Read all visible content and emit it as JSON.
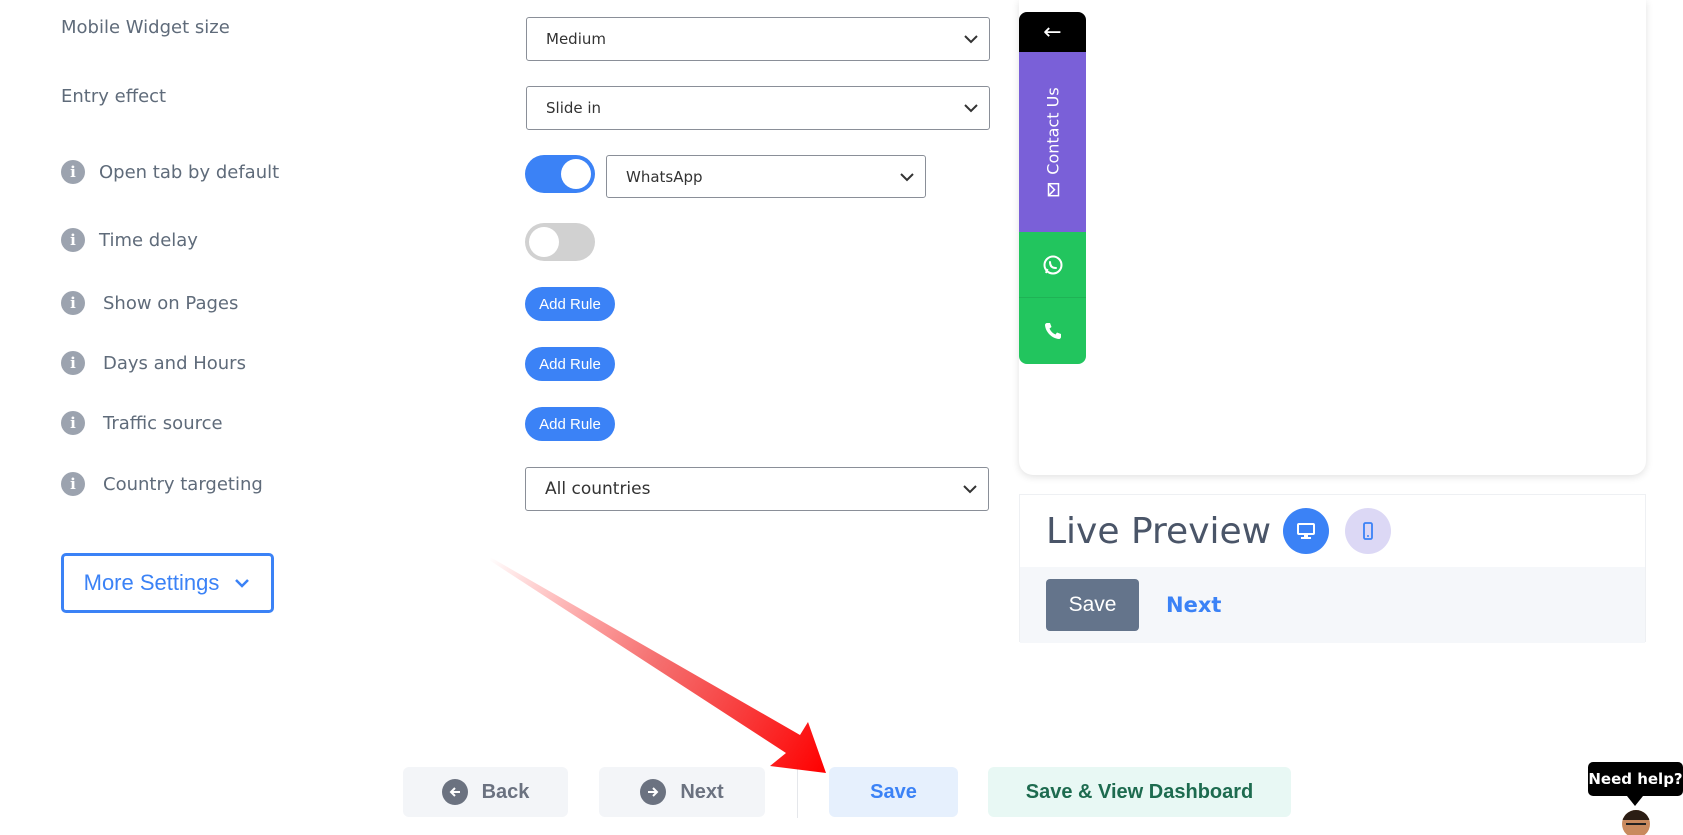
{
  "settings": {
    "mobile_widget_size": {
      "label": "Mobile Widget size",
      "value": "Medium"
    },
    "entry_effect": {
      "label": "Entry effect",
      "value": "Slide in"
    },
    "open_tab_default": {
      "label": "Open tab by default",
      "enabled": true,
      "value": "WhatsApp"
    },
    "time_delay": {
      "label": "Time delay",
      "enabled": false
    },
    "show_on_pages": {
      "label": "Show on Pages",
      "button": "Add Rule"
    },
    "days_hours": {
      "label": "Days and Hours",
      "button": "Add Rule"
    },
    "traffic_source": {
      "label": "Traffic source",
      "button": "Add Rule"
    },
    "country_targeting": {
      "label": "Country targeting",
      "value": "All countries"
    },
    "more_settings": "More Settings"
  },
  "widget_preview": {
    "back_glyph": "←",
    "contact_label": "Contact Us",
    "channels": [
      "whatsapp-icon",
      "phone-icon"
    ]
  },
  "live_preview": {
    "title": "Live Preview",
    "save": "Save",
    "next": "Next"
  },
  "footer": {
    "back": "Back",
    "next": "Next",
    "save": "Save",
    "save_dashboard": "Save & View Dashboard"
  },
  "help": {
    "bubble": "Need help?"
  },
  "colors": {
    "primary": "#3b82f6",
    "contact_purple": "#7a60d8",
    "whatsapp_green": "#22c55e",
    "arrow_red": "#ff0000"
  }
}
